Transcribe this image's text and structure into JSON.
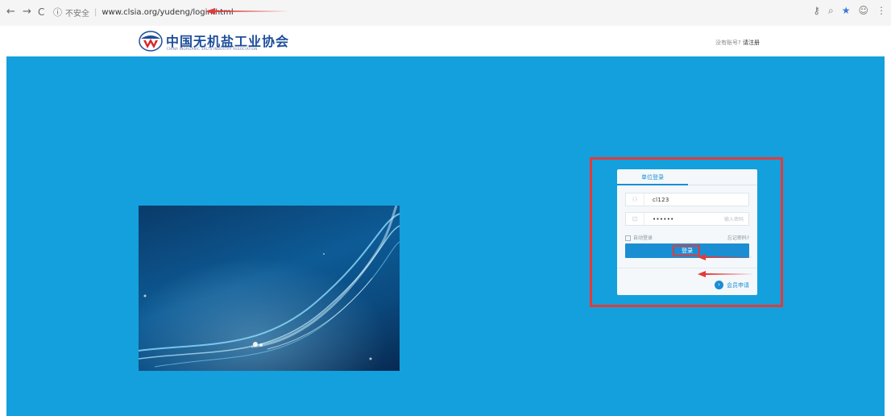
{
  "browser": {
    "back": "←",
    "forward": "→",
    "reload": "C",
    "info_icon": "ⓘ",
    "insecure_label": "不安全",
    "separator": "|",
    "url": "www.clsia.org/yudeng/login.html",
    "icons": {
      "key": "key-icon",
      "zoom": "search-icon",
      "star": "star-icon",
      "account": "account-icon",
      "menu": "menu-icon"
    }
  },
  "header": {
    "title": "中国无机盐工业协会",
    "subtitle": "CHINA INORGANIC SALTS INDUSTRY ASSOCIATION",
    "no_account": "没有账号?",
    "register_link": "请注册"
  },
  "login": {
    "tab_label": "单位登录",
    "username_value": "cl123",
    "password_value": "••••••",
    "password_hint": "输入密码",
    "auto_login_label": "自动登录",
    "forgot_link": "忘记密码?",
    "submit_label": "登录",
    "member_apply": "会员申请"
  },
  "colors": {
    "banner": "#14a0dc",
    "accent": "#1a8ed3",
    "annotation": "#e23b3b",
    "title": "#1d4e9b"
  }
}
